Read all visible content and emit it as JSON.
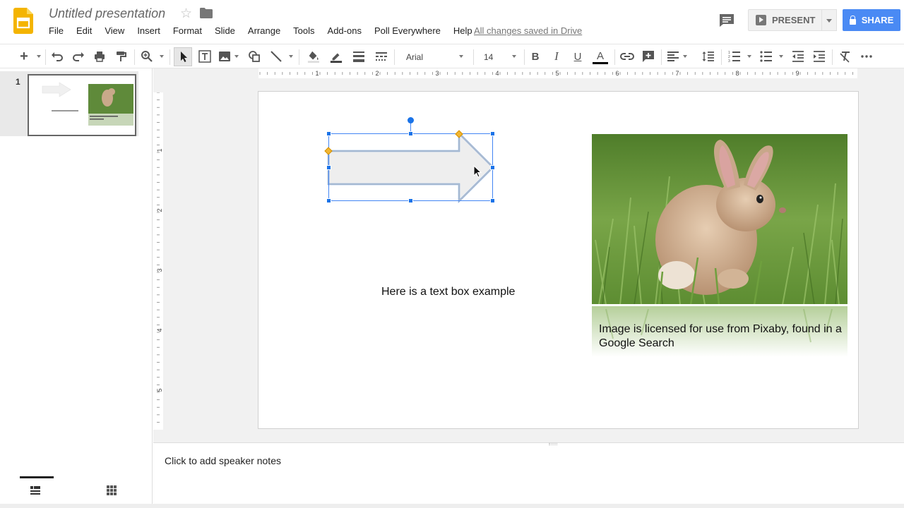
{
  "header": {
    "title": "Untitled presentation",
    "menu": [
      "File",
      "Edit",
      "View",
      "Insert",
      "Format",
      "Slide",
      "Arrange",
      "Tools",
      "Add-ons",
      "Poll Everywhere",
      "Help"
    ],
    "save_status": "All changes saved in Drive",
    "present_label": "PRESENT",
    "share_label": "SHARE",
    "colors": {
      "share": "#4a8af4",
      "logo": "#f4b400"
    }
  },
  "toolbar": {
    "font": "Arial",
    "font_size": "14",
    "text_color": "#000000",
    "icons": [
      "new-slide-icon",
      "undo-icon",
      "redo-icon",
      "print-icon",
      "paint-format-icon",
      "zoom-icon",
      "select-icon",
      "text-box-icon",
      "image-icon",
      "shape-icon",
      "line-icon",
      "fill-color-icon",
      "border-color-icon",
      "border-weight-icon",
      "border-dash-icon",
      "bold-icon",
      "italic-icon",
      "underline-icon",
      "text-color-icon",
      "link-icon",
      "comment-add-icon",
      "align-icon",
      "line-spacing-icon",
      "numbered-list-icon",
      "bulleted-list-icon",
      "decrease-indent-icon",
      "increase-indent-icon",
      "clear-formatting-icon",
      "more-icon"
    ]
  },
  "filmstrip": {
    "slides": [
      {
        "number": "1"
      }
    ]
  },
  "slide": {
    "text_box": "Here is a text box example",
    "image_caption": "Image is licensed for use from Pixaby, found in a Google Search",
    "selected_shape": "right-arrow"
  },
  "notes": {
    "placeholder": "Click to add speaker notes"
  }
}
